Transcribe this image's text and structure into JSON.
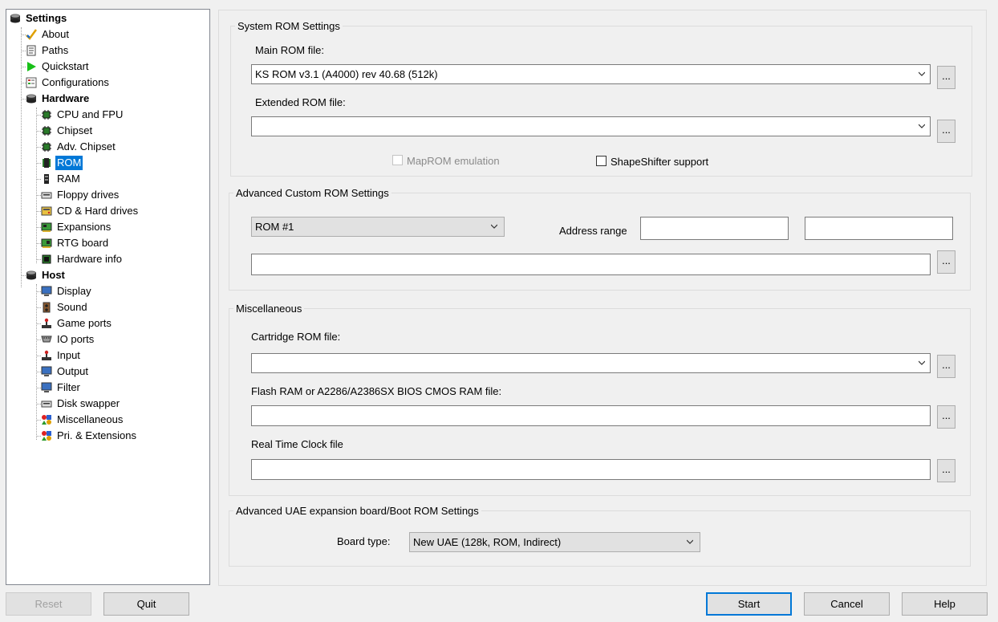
{
  "tree": {
    "root": "Settings",
    "items": [
      {
        "label": "About",
        "icon": "checkmark-icon"
      },
      {
        "label": "Paths",
        "icon": "document-icon"
      },
      {
        "label": "Quickstart",
        "icon": "play-icon"
      },
      {
        "label": "Configurations",
        "icon": "form-icon"
      },
      {
        "label": "Hardware",
        "icon": "disk-stack-icon"
      },
      {
        "label": "CPU and FPU",
        "icon": "chip-icon"
      },
      {
        "label": "Chipset",
        "icon": "chip-icon"
      },
      {
        "label": "Adv. Chipset",
        "icon": "chip-icon"
      },
      {
        "label": "ROM",
        "icon": "rom-chip-icon"
      },
      {
        "label": "RAM",
        "icon": "ram-icon"
      },
      {
        "label": "Floppy drives",
        "icon": "floppy-drive-icon"
      },
      {
        "label": "CD & Hard drives",
        "icon": "hard-drive-icon"
      },
      {
        "label": "Expansions",
        "icon": "expansion-card-icon"
      },
      {
        "label": "RTG board",
        "icon": "graphics-card-icon"
      },
      {
        "label": "Hardware info",
        "icon": "info-board-icon"
      },
      {
        "label": "Host",
        "icon": "disk-stack-icon"
      },
      {
        "label": "Display",
        "icon": "monitor-icon"
      },
      {
        "label": "Sound",
        "icon": "speaker-icon"
      },
      {
        "label": "Game ports",
        "icon": "joystick-icon"
      },
      {
        "label": "IO ports",
        "icon": "port-icon"
      },
      {
        "label": "Input",
        "icon": "joystick-icon"
      },
      {
        "label": "Output",
        "icon": "monitor-icon"
      },
      {
        "label": "Filter",
        "icon": "monitor-icon"
      },
      {
        "label": "Disk swapper",
        "icon": "floppy-drive-icon"
      },
      {
        "label": "Miscellaneous",
        "icon": "shapes-icon"
      },
      {
        "label": "Pri. & Extensions",
        "icon": "shapes-icon"
      }
    ]
  },
  "system_rom": {
    "title": "System ROM Settings",
    "main_label": "Main ROM file:",
    "main_value": "KS ROM v3.1 (A4000) rev 40.68 (512k)",
    "ext_label": "Extended ROM file:",
    "ext_value": "",
    "maprom_label": "MapROM emulation",
    "shapeshifter_label": "ShapeShifter support",
    "browse_label": "..."
  },
  "custom_rom": {
    "title": "Advanced Custom ROM Settings",
    "rom_select": "ROM #1",
    "address_label": "Address range",
    "addr_start": "",
    "addr_end": "",
    "file_value": ""
  },
  "misc": {
    "title": "Miscellaneous",
    "cart_label": "Cartridge ROM file:",
    "cart_value": "",
    "flash_label": "Flash RAM or A2286/A2386SX BIOS CMOS RAM file:",
    "flash_value": "",
    "rtc_label": "Real Time Clock file",
    "rtc_value": ""
  },
  "uae_board": {
    "title": "Advanced UAE expansion board/Boot ROM Settings",
    "board_label": "Board type:",
    "board_value": "New UAE (128k, ROM, Indirect)"
  },
  "buttons": {
    "reset": "Reset",
    "quit": "Quit",
    "start": "Start",
    "cancel": "Cancel",
    "help": "Help"
  }
}
